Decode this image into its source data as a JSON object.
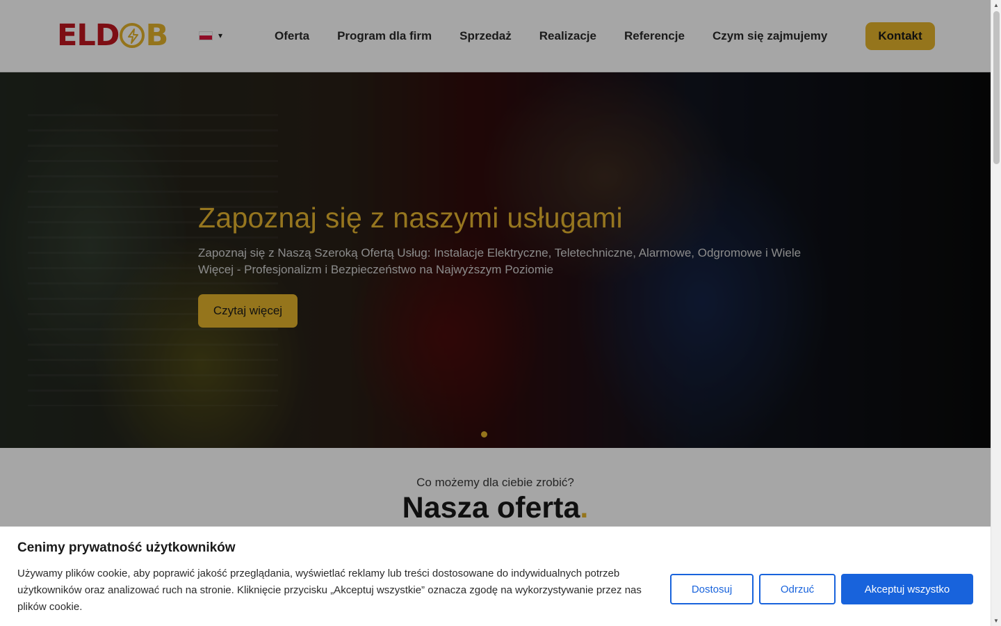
{
  "header": {
    "logo": {
      "part1": "EL",
      "part2": "D",
      "part3": "B"
    },
    "language": {
      "flag": "flag-pl-icon",
      "caret": "▾"
    },
    "nav": [
      {
        "label": "Oferta"
      },
      {
        "label": "Program dla firm"
      },
      {
        "label": "Sprzedaż"
      },
      {
        "label": "Realizacje"
      },
      {
        "label": "Referencje"
      },
      {
        "label": "Czym się zajmujemy"
      }
    ],
    "contact_label": "Kontakt"
  },
  "hero": {
    "title": "Zapoznaj się z naszymi usługami",
    "subtitle": "Zapoznaj się z Naszą Szeroką Ofertą Usług: Instalacje Elektryczne, Teletechniczne, Alarmowe, Odgromowe i Wiele Więcej - Profesjonalizm i Bezpieczeństwo na Najwyższym Poziomie",
    "button_label": "Czytaj więcej"
  },
  "offer": {
    "kicker": "Co możemy dla ciebie zrobić?",
    "title": "Nasza oferta",
    "title_dot": "."
  },
  "cookie": {
    "title": "Cenimy prywatność użytkowników",
    "text": "Używamy plików cookie, aby poprawić jakość przeglądania, wyświetlać reklamy lub treści dostosowane do indywidualnych potrzeb użytkowników oraz analizować ruch na stronie. Kliknięcie przycisku „Akceptuj wszystkie” oznacza zgodę na wykorzystywanie przez nas plików cookie.",
    "customize_label": "Dostosuj",
    "reject_label": "Odrzuć",
    "accept_label": "Akceptuj wszystko"
  },
  "colors": {
    "accent_gold": "#e5b42c",
    "logo_red": "#c0161f",
    "cookie_blue": "#1863dc"
  }
}
